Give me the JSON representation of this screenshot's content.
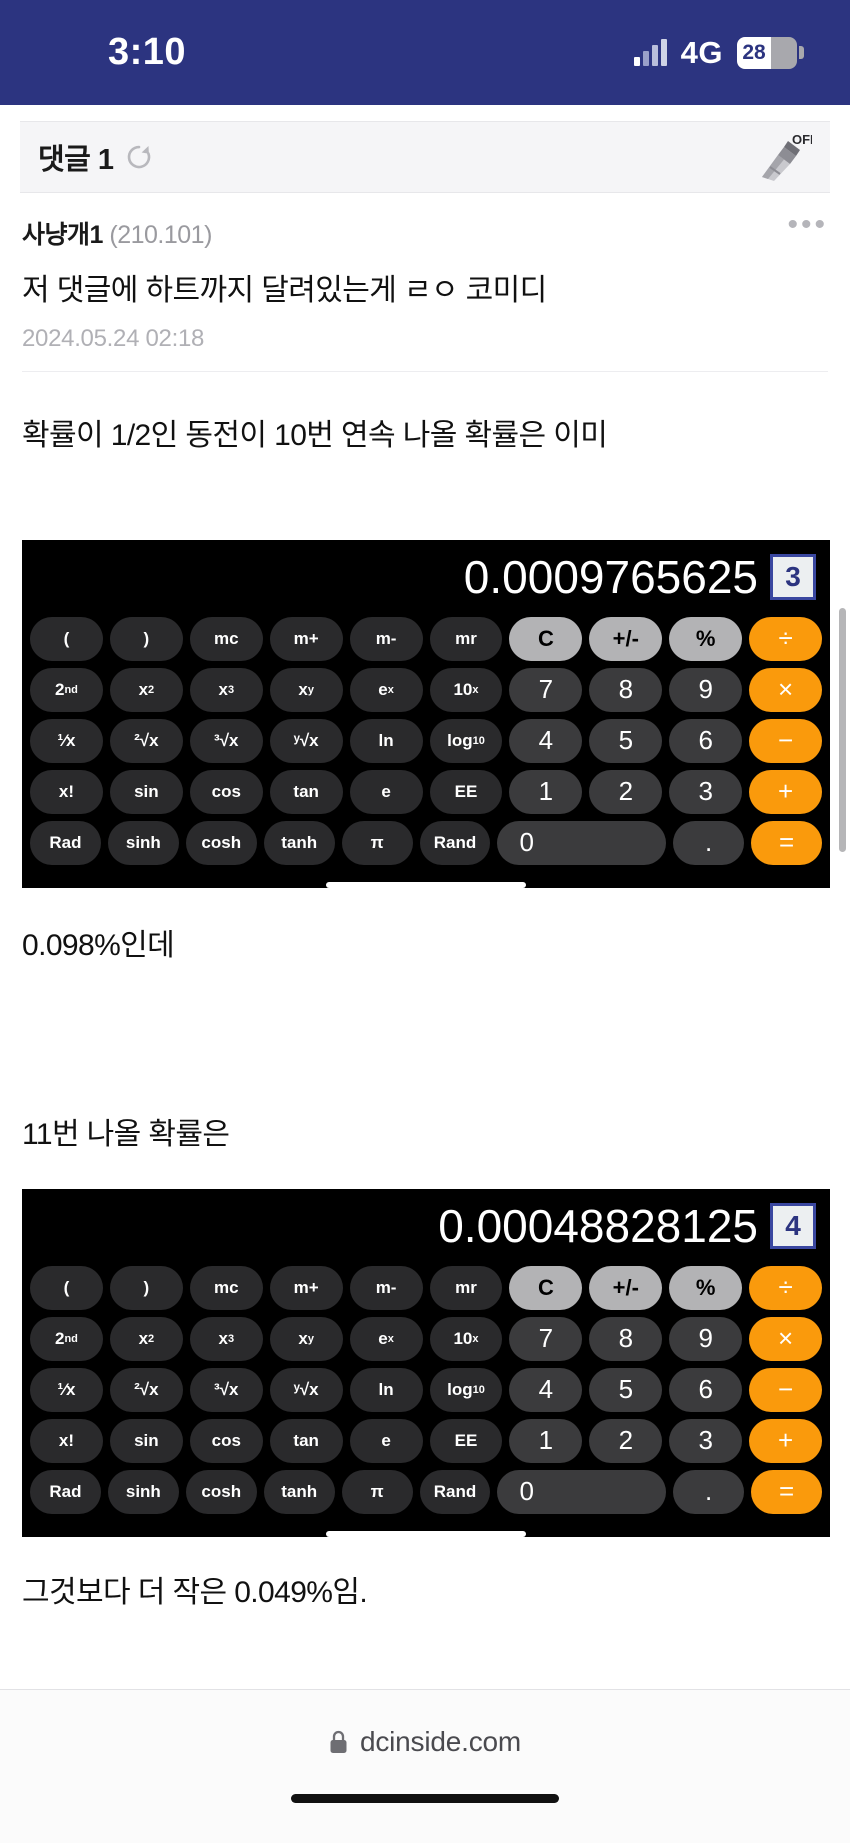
{
  "status_bar": {
    "time": "3:10",
    "network": "4G",
    "battery_level": "28",
    "signal_icon": "cellular-signal-icon",
    "battery_icon": "battery-icon",
    "background_color": "#2c3480"
  },
  "comment_header": {
    "title": "댓글 1",
    "refresh_icon": "refresh-icon",
    "broom_icon": "broom-off-icon",
    "broom_label": "OFF"
  },
  "comment": {
    "author": "사냥개",
    "author_suffix": "1",
    "ip": "(210.101)",
    "text": "저 댓글에 하트까지 달려있는게 ㄹㅇ 코미디",
    "date": "2024.05.24 02:18",
    "more_icon": "more-options-icon"
  },
  "post": {
    "line1": "확률이 1/2인 동전이 10번 연속 나올 확률은 이미",
    "line2": "0.098%인데",
    "line3": "11번 나올 확률은",
    "line4": "그것보다 더 작은 0.049%임."
  },
  "calculators": [
    {
      "display_value": "0.0009765625",
      "badge": "3",
      "accent_color": "#fa9a0c",
      "rows": [
        [
          {
            "label": "(",
            "style": "fn"
          },
          {
            "label": ")",
            "style": "fn"
          },
          {
            "label": "mc",
            "style": "fn"
          },
          {
            "label": "m+",
            "style": "fn"
          },
          {
            "label": "m-",
            "style": "fn"
          },
          {
            "label": "mr",
            "style": "fn"
          },
          {
            "label": "C",
            "style": "top"
          },
          {
            "label": "+/-",
            "style": "top"
          },
          {
            "label": "%",
            "style": "top"
          },
          {
            "label": "÷",
            "style": "op"
          }
        ],
        [
          {
            "label": "2nd",
            "style": "fn",
            "sup": "nd",
            "base": "2"
          },
          {
            "label": "x²",
            "style": "fn",
            "sup": "2",
            "base": "x"
          },
          {
            "label": "x³",
            "style": "fn",
            "sup": "3",
            "base": "x"
          },
          {
            "label": "xʸ",
            "style": "fn",
            "sup": "y",
            "base": "x"
          },
          {
            "label": "eˣ",
            "style": "fn",
            "sup": "x",
            "base": "e"
          },
          {
            "label": "10ˣ",
            "style": "fn",
            "sup": "x",
            "base": "10"
          },
          {
            "label": "7",
            "style": "num"
          },
          {
            "label": "8",
            "style": "num"
          },
          {
            "label": "9",
            "style": "num"
          },
          {
            "label": "×",
            "style": "op"
          }
        ],
        [
          {
            "label": "¹⁄x",
            "style": "fn"
          },
          {
            "label": "²√x",
            "style": "fn"
          },
          {
            "label": "³√x",
            "style": "fn"
          },
          {
            "label": "ʸ√x",
            "style": "fn"
          },
          {
            "label": "ln",
            "style": "fn"
          },
          {
            "label": "log₁₀",
            "style": "fn",
            "sub": "10",
            "base": "log"
          },
          {
            "label": "4",
            "style": "num"
          },
          {
            "label": "5",
            "style": "num"
          },
          {
            "label": "6",
            "style": "num"
          },
          {
            "label": "−",
            "style": "op"
          }
        ],
        [
          {
            "label": "x!",
            "style": "fn"
          },
          {
            "label": "sin",
            "style": "fn"
          },
          {
            "label": "cos",
            "style": "fn"
          },
          {
            "label": "tan",
            "style": "fn"
          },
          {
            "label": "e",
            "style": "fn"
          },
          {
            "label": "EE",
            "style": "fn"
          },
          {
            "label": "1",
            "style": "num"
          },
          {
            "label": "2",
            "style": "num"
          },
          {
            "label": "3",
            "style": "num"
          },
          {
            "label": "+",
            "style": "op"
          }
        ],
        [
          {
            "label": "Rad",
            "style": "fn"
          },
          {
            "label": "sinh",
            "style": "fn"
          },
          {
            "label": "cosh",
            "style": "fn"
          },
          {
            "label": "tanh",
            "style": "fn"
          },
          {
            "label": "π",
            "style": "fn"
          },
          {
            "label": "Rand",
            "style": "fn"
          },
          {
            "label": "0",
            "style": "num zero"
          },
          {
            "label": ".",
            "style": "num"
          },
          {
            "label": "=",
            "style": "op"
          }
        ]
      ]
    },
    {
      "display_value": "0.00048828125",
      "badge": "4",
      "accent_color": "#fa9a0c"
    }
  ],
  "footer": {
    "url": "dcinside.com",
    "lock_icon": "lock-icon",
    "home_indicator": "home-indicator"
  }
}
